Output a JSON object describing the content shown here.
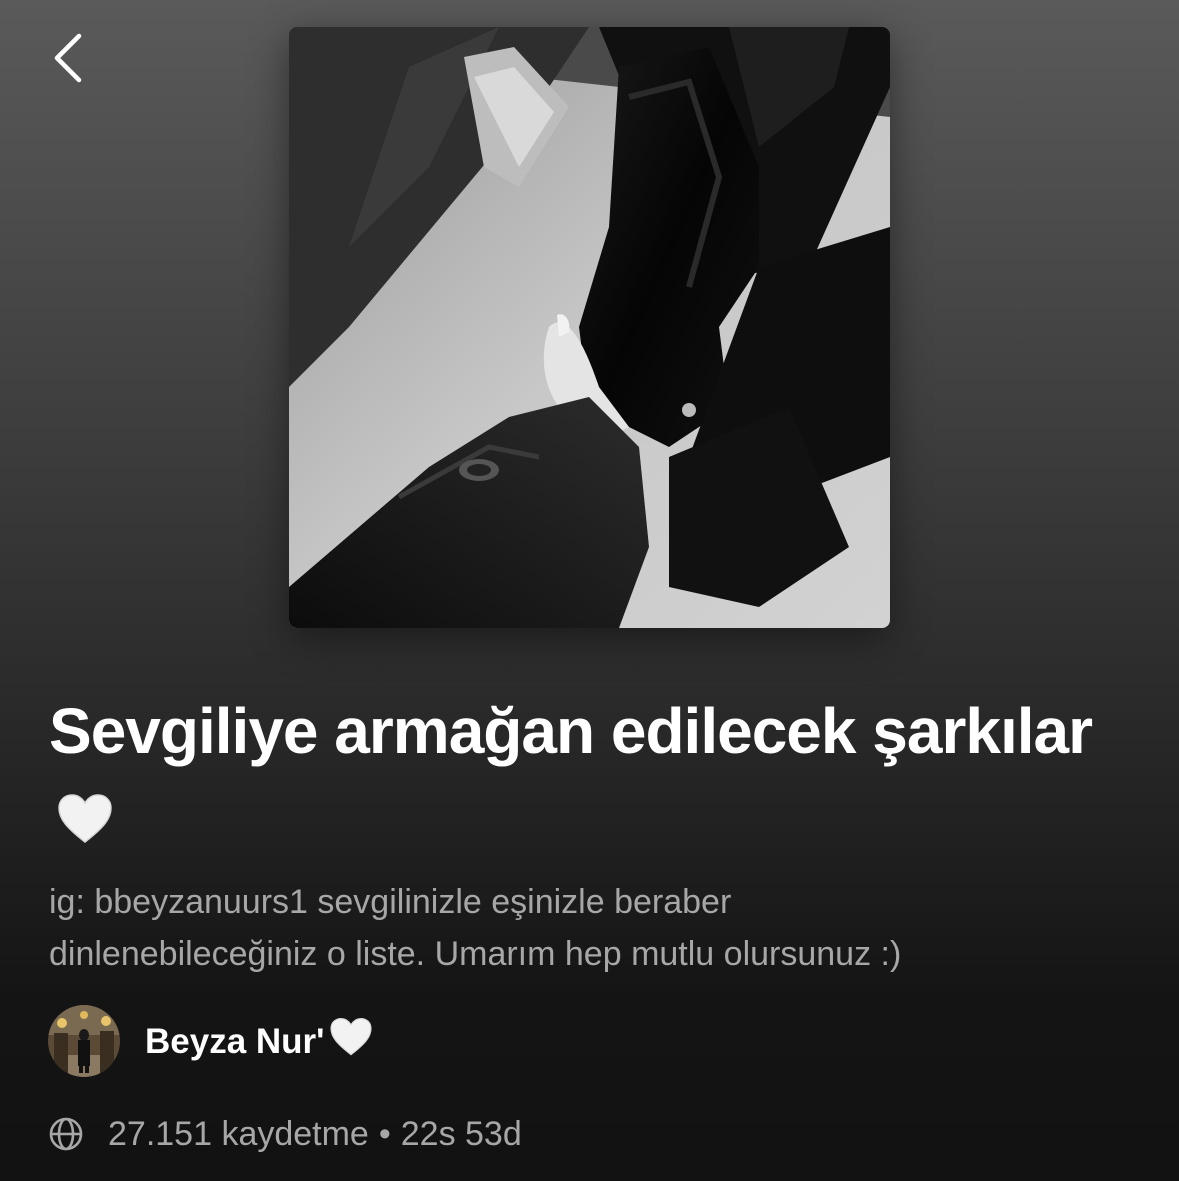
{
  "header": {
    "back_icon": "chevron-left-icon"
  },
  "playlist": {
    "cover_alt": "Siyah beyaz playlist kapak fotoğrafı",
    "title": "Sevgiliye armağan edilecek şarkılar",
    "title_emoji": "🤍",
    "description_line1": "ig: bbeyzanuurs1  sevgilinizle eşinizle beraber",
    "description_line2": "dinlenebileceğiniz o liste. Umarım hep mutlu olursunuz :)"
  },
  "owner": {
    "name": "Beyza Nur'",
    "emoji": "🤍"
  },
  "meta": {
    "visibility_icon": "globe-icon",
    "saves": "27.151 kaydetme",
    "separator": "•",
    "duration": "22s 53d"
  },
  "colors": {
    "text_primary": "#ffffff",
    "text_secondary": "#a7a7a7",
    "background_top": "#5a5a5a",
    "background_bottom": "#121212"
  }
}
